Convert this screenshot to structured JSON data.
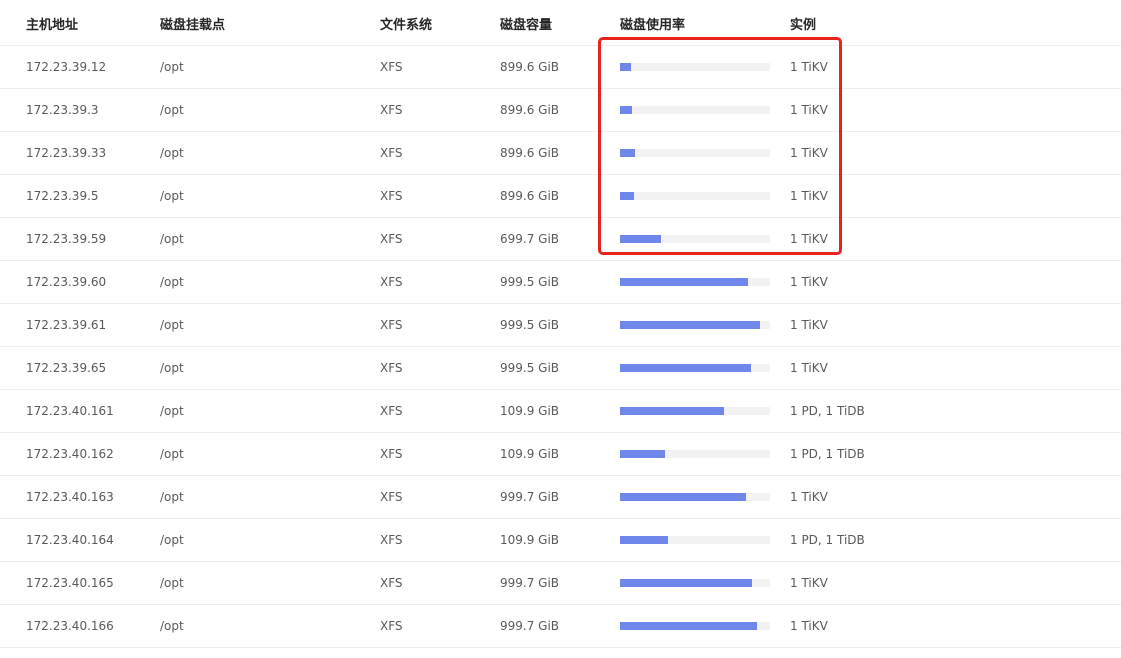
{
  "columns": {
    "host": "主机地址",
    "mount": "磁盘挂载点",
    "fs": "文件系统",
    "capacity": "磁盘容量",
    "usage": "磁盘使用率",
    "instance": "实例"
  },
  "colors": {
    "bar_fill": "#6f86ea",
    "bar_track": "#f2f2f2",
    "highlight": "#e8231f"
  },
  "rows": [
    {
      "host": "172.23.39.12",
      "mount": "/opt",
      "fs": "XFS",
      "capacity": "899.6 GiB",
      "usage_fraction": 0.07,
      "instance": "1 TiKV"
    },
    {
      "host": "172.23.39.3",
      "mount": "/opt",
      "fs": "XFS",
      "capacity": "899.6 GiB",
      "usage_fraction": 0.08,
      "instance": "1 TiKV"
    },
    {
      "host": "172.23.39.33",
      "mount": "/opt",
      "fs": "XFS",
      "capacity": "899.6 GiB",
      "usage_fraction": 0.1,
      "instance": "1 TiKV"
    },
    {
      "host": "172.23.39.5",
      "mount": "/opt",
      "fs": "XFS",
      "capacity": "899.6 GiB",
      "usage_fraction": 0.09,
      "instance": "1 TiKV"
    },
    {
      "host": "172.23.39.59",
      "mount": "/opt",
      "fs": "XFS",
      "capacity": "699.7 GiB",
      "usage_fraction": 0.27,
      "instance": "1 TiKV"
    },
    {
      "host": "172.23.39.60",
      "mount": "/opt",
      "fs": "XFS",
      "capacity": "999.5 GiB",
      "usage_fraction": 0.85,
      "instance": "1 TiKV"
    },
    {
      "host": "172.23.39.61",
      "mount": "/opt",
      "fs": "XFS",
      "capacity": "999.5 GiB",
      "usage_fraction": 0.93,
      "instance": "1 TiKV"
    },
    {
      "host": "172.23.39.65",
      "mount": "/opt",
      "fs": "XFS",
      "capacity": "999.5 GiB",
      "usage_fraction": 0.87,
      "instance": "1 TiKV"
    },
    {
      "host": "172.23.40.161",
      "mount": "/opt",
      "fs": "XFS",
      "capacity": "109.9 GiB",
      "usage_fraction": 0.69,
      "instance": "1 PD, 1 TiDB"
    },
    {
      "host": "172.23.40.162",
      "mount": "/opt",
      "fs": "XFS",
      "capacity": "109.9 GiB",
      "usage_fraction": 0.3,
      "instance": "1 PD, 1 TiDB"
    },
    {
      "host": "172.23.40.163",
      "mount": "/opt",
      "fs": "XFS",
      "capacity": "999.7 GiB",
      "usage_fraction": 0.84,
      "instance": "1 TiKV"
    },
    {
      "host": "172.23.40.164",
      "mount": "/opt",
      "fs": "XFS",
      "capacity": "109.9 GiB",
      "usage_fraction": 0.32,
      "instance": "1 PD, 1 TiDB"
    },
    {
      "host": "172.23.40.165",
      "mount": "/opt",
      "fs": "XFS",
      "capacity": "999.7 GiB",
      "usage_fraction": 0.88,
      "instance": "1 TiKV"
    },
    {
      "host": "172.23.40.166",
      "mount": "/opt",
      "fs": "XFS",
      "capacity": "999.7 GiB",
      "usage_fraction": 0.91,
      "instance": "1 TiKV"
    }
  ]
}
